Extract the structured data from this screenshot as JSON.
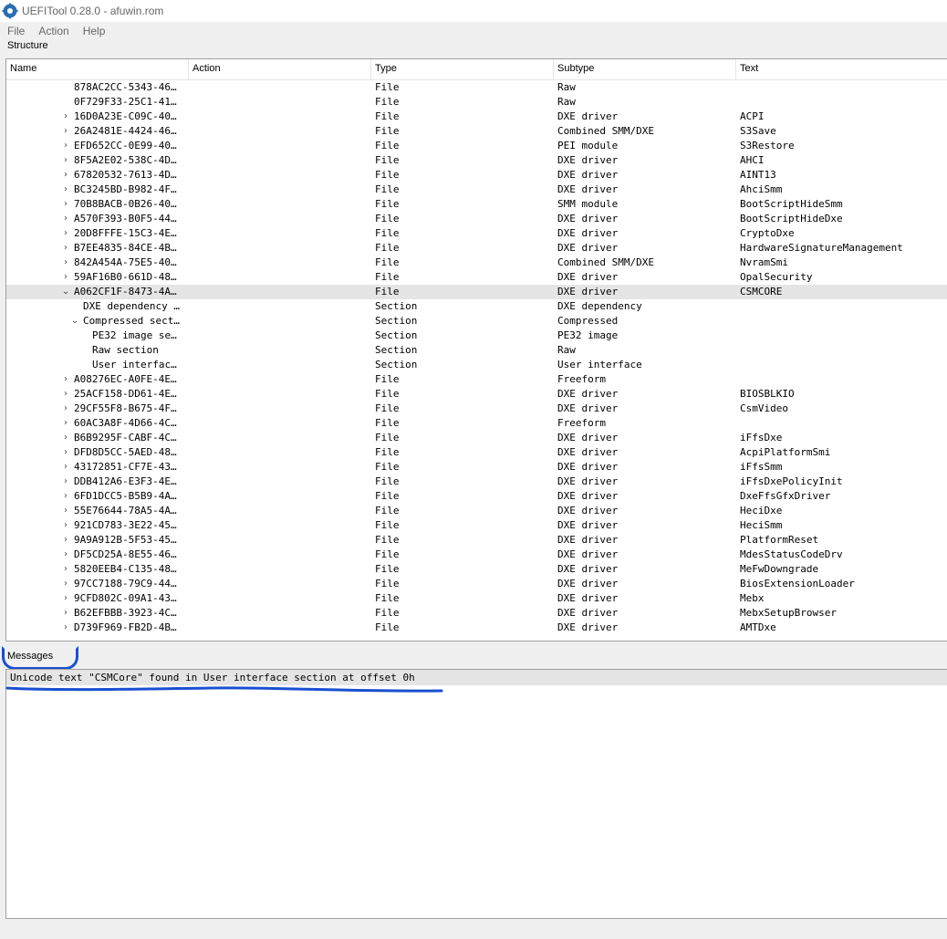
{
  "window": {
    "title": "UEFITool 0.28.0 - afuwin.rom"
  },
  "menu": {
    "items": [
      "File",
      "Action",
      "Help"
    ]
  },
  "structure": {
    "label": "Structure",
    "columns": [
      "Name",
      "Action",
      "Type",
      "Subtype",
      "Text"
    ],
    "rows": [
      {
        "name": "878AC2CC-5343-46…",
        "type": "File",
        "subtype": "Raw",
        "text": "",
        "level": 0,
        "expander": ""
      },
      {
        "name": "0F729F33-25C1-41…",
        "type": "File",
        "subtype": "Raw",
        "text": "",
        "level": 0,
        "expander": ""
      },
      {
        "name": "16D0A23E-C09C-40…",
        "type": "File",
        "subtype": "DXE driver",
        "text": "ACPI",
        "level": 0,
        "expander": "collapsed"
      },
      {
        "name": "26A2481E-4424-46…",
        "type": "File",
        "subtype": "Combined SMM/DXE",
        "text": "S3Save",
        "level": 0,
        "expander": "collapsed"
      },
      {
        "name": "EFD652CC-0E99-40…",
        "type": "File",
        "subtype": "PEI module",
        "text": "S3Restore",
        "level": 0,
        "expander": "collapsed"
      },
      {
        "name": "8F5A2E02-538C-4D…",
        "type": "File",
        "subtype": "DXE driver",
        "text": "AHCI",
        "level": 0,
        "expander": "collapsed"
      },
      {
        "name": "67820532-7613-4D…",
        "type": "File",
        "subtype": "DXE driver",
        "text": "AINT13",
        "level": 0,
        "expander": "collapsed"
      },
      {
        "name": "BC3245BD-B982-4F…",
        "type": "File",
        "subtype": "DXE driver",
        "text": "AhciSmm",
        "level": 0,
        "expander": "collapsed"
      },
      {
        "name": "70B8BACB-0B26-40…",
        "type": "File",
        "subtype": "SMM module",
        "text": "BootScriptHideSmm",
        "level": 0,
        "expander": "collapsed"
      },
      {
        "name": "A570F393-B0F5-44…",
        "type": "File",
        "subtype": "DXE driver",
        "text": "BootScriptHideDxe",
        "level": 0,
        "expander": "collapsed"
      },
      {
        "name": "20D8FFFE-15C3-4E…",
        "type": "File",
        "subtype": "DXE driver",
        "text": "CryptoDxe",
        "level": 0,
        "expander": "collapsed"
      },
      {
        "name": "B7EE4835-84CE-4B…",
        "type": "File",
        "subtype": "DXE driver",
        "text": "HardwareSignatureManagement",
        "level": 0,
        "expander": "collapsed"
      },
      {
        "name": "842A454A-75E5-40…",
        "type": "File",
        "subtype": "Combined SMM/DXE",
        "text": "NvramSmi",
        "level": 0,
        "expander": "collapsed"
      },
      {
        "name": "59AF16B0-661D-48…",
        "type": "File",
        "subtype": "DXE driver",
        "text": "OpalSecurity",
        "level": 0,
        "expander": "collapsed"
      },
      {
        "name": "A062CF1F-8473-4A…",
        "type": "File",
        "subtype": "DXE driver",
        "text": "CSMCORE",
        "level": 0,
        "expander": "expanded",
        "selected": true
      },
      {
        "name": "DXE dependency …",
        "type": "Section",
        "subtype": "DXE dependency",
        "text": "",
        "level": 1,
        "expander": ""
      },
      {
        "name": "Compressed sect…",
        "type": "Section",
        "subtype": "Compressed",
        "text": "",
        "level": 1,
        "expander": "expanded"
      },
      {
        "name": "PE32 image se…",
        "type": "Section",
        "subtype": "PE32 image",
        "text": "",
        "level": 2,
        "expander": ""
      },
      {
        "name": "Raw section",
        "type": "Section",
        "subtype": "Raw",
        "text": "",
        "level": 2,
        "expander": ""
      },
      {
        "name": "User interfac…",
        "type": "Section",
        "subtype": "User interface",
        "text": "",
        "level": 2,
        "expander": ""
      },
      {
        "name": "A08276EC-A0FE-4E…",
        "type": "File",
        "subtype": "Freeform",
        "text": "",
        "level": 0,
        "expander": "collapsed"
      },
      {
        "name": "25ACF158-DD61-4E…",
        "type": "File",
        "subtype": "DXE driver",
        "text": "BIOSBLKIO",
        "level": 0,
        "expander": "collapsed"
      },
      {
        "name": "29CF55F8-B675-4F…",
        "type": "File",
        "subtype": "DXE driver",
        "text": "CsmVideo",
        "level": 0,
        "expander": "collapsed"
      },
      {
        "name": "60AC3A8F-4D66-4C…",
        "type": "File",
        "subtype": "Freeform",
        "text": "",
        "level": 0,
        "expander": "collapsed"
      },
      {
        "name": "B6B9295F-CABF-4C…",
        "type": "File",
        "subtype": "DXE driver",
        "text": "iFfsDxe",
        "level": 0,
        "expander": "collapsed"
      },
      {
        "name": "DFD8D5CC-5AED-48…",
        "type": "File",
        "subtype": "DXE driver",
        "text": "AcpiPlatformSmi",
        "level": 0,
        "expander": "collapsed"
      },
      {
        "name": "43172851-CF7E-43…",
        "type": "File",
        "subtype": "DXE driver",
        "text": "iFfsSmm",
        "level": 0,
        "expander": "collapsed"
      },
      {
        "name": "DDB412A6-E3F3-4E…",
        "type": "File",
        "subtype": "DXE driver",
        "text": "iFfsDxePolicyInit",
        "level": 0,
        "expander": "collapsed"
      },
      {
        "name": "6FD1DCC5-B5B9-4A…",
        "type": "File",
        "subtype": "DXE driver",
        "text": "DxeFfsGfxDriver",
        "level": 0,
        "expander": "collapsed"
      },
      {
        "name": "55E76644-78A5-4A…",
        "type": "File",
        "subtype": "DXE driver",
        "text": "HeciDxe",
        "level": 0,
        "expander": "collapsed"
      },
      {
        "name": "921CD783-3E22-45…",
        "type": "File",
        "subtype": "DXE driver",
        "text": "HeciSmm",
        "level": 0,
        "expander": "collapsed"
      },
      {
        "name": "9A9A912B-5F53-45…",
        "type": "File",
        "subtype": "DXE driver",
        "text": "PlatformReset",
        "level": 0,
        "expander": "collapsed"
      },
      {
        "name": "DF5CD25A-8E55-46…",
        "type": "File",
        "subtype": "DXE driver",
        "text": "MdesStatusCodeDrv",
        "level": 0,
        "expander": "collapsed"
      },
      {
        "name": "5820EEB4-C135-48…",
        "type": "File",
        "subtype": "DXE driver",
        "text": "MeFwDowngrade",
        "level": 0,
        "expander": "collapsed"
      },
      {
        "name": "97CC7188-79C9-44…",
        "type": "File",
        "subtype": "DXE driver",
        "text": "BiosExtensionLoader",
        "level": 0,
        "expander": "collapsed"
      },
      {
        "name": "9CFD802C-09A1-43…",
        "type": "File",
        "subtype": "DXE driver",
        "text": "Mebx",
        "level": 0,
        "expander": "collapsed"
      },
      {
        "name": "B62EFBBB-3923-4C…",
        "type": "File",
        "subtype": "DXE driver",
        "text": "MebxSetupBrowser",
        "level": 0,
        "expander": "collapsed"
      },
      {
        "name": "D739F969-FB2D-4B…",
        "type": "File",
        "subtype": "DXE driver",
        "text": "AMTDxe",
        "level": 0,
        "expander": "collapsed"
      }
    ]
  },
  "messages": {
    "label": "Messages",
    "items": [
      "Unicode text \"CSMCore\" found in User interface section at offset 0h"
    ]
  }
}
